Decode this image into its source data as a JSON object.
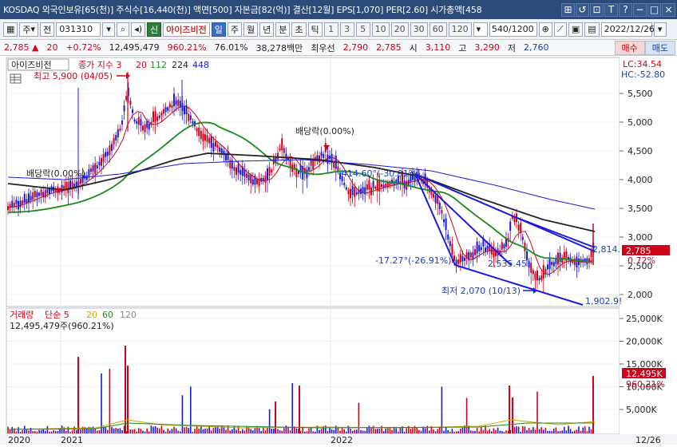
{
  "window": {
    "title": "KOSDAQ 외국인보유[65(천)] 주식수[16,440(천)] 액면[500] 자본금[82(억)] 결산[12월] EPS[1,070] PER[2.60] 시가총액[458",
    "buttons": [
      "⊞",
      "↺",
      "⊡",
      "T",
      "?",
      "−",
      "□",
      "×"
    ]
  },
  "toolbar": {
    "market_label": "주",
    "prev_label": "전",
    "code": "031310",
    "search_icon": "search-icon",
    "sound_icon": "speaker-icon",
    "new_badge": "신",
    "stock_name": "아이즈비전",
    "periods": [
      "일",
      "주",
      "월",
      "년",
      "분",
      "초",
      "틱"
    ],
    "active_period": "일",
    "intervals": [
      "1",
      "3",
      "5",
      "10",
      "20",
      "30",
      "60",
      "120"
    ],
    "count": "540",
    "count_total": "/1200",
    "date": "2022/12/26"
  },
  "quote": {
    "price": "2,785",
    "change_arrow": "▲",
    "change": "20",
    "change_pct": "+0.72%",
    "volume": "12,495,479",
    "volume_ratio": "960.21%",
    "turnover": "76.01%",
    "amount": "38,278백만",
    "pref_label": "최우선",
    "pref_sell": "2,790",
    "pref_buy": "2,785",
    "open_label": "시",
    "open": "3,110",
    "high_label": "고",
    "high": "3,290",
    "low_label": "저",
    "low": "2,760",
    "buy_label": "매수",
    "sell_label": "매도"
  },
  "chart": {
    "stock_tag": "아이즈비전",
    "legend_label": "종가 지수 3",
    "ma_periods": [
      {
        "label": "20",
        "color": "#d0021b"
      },
      {
        "label": "112",
        "color": "#1a8a1a"
      },
      {
        "label": "224",
        "color": "#222222"
      },
      {
        "label": "448",
        "color": "#1a1adb"
      }
    ],
    "lc": "LC:34.54",
    "hc": "HC:-52.80",
    "price_ticks": [
      "5,500",
      "5,000",
      "4,500",
      "4,000",
      "3,500",
      "3,000",
      "2,500",
      "2,000"
    ],
    "annotations": {
      "high": "최고 5,900 (04/05)",
      "low": "최저 2,070 (10/13)",
      "div1": "배당락(0.00%)",
      "div2": "배당락(0.00%)",
      "trend1": "-414.60°(-30.91%)",
      "trend2": "-17.27°(-26.91%)",
      "trend3": "2,535.45",
      "trend4": "2,814.",
      "trend5": "1,902.9!"
    },
    "price_tag": "2,785",
    "pct_tag": "0.72%",
    "volume_legend": {
      "label": "거래량",
      "ma_label": "단순 5",
      "periods": [
        {
          "label": "20",
          "color": "#d4a000"
        },
        {
          "label": "60",
          "color": "#1a8a1a"
        },
        {
          "label": "120",
          "color": "#888888"
        }
      ],
      "current": "12,495,479주(960.21%)"
    },
    "volume_ticks": [
      "25,000K",
      "20,000K",
      "15,000K",
      "10,000K",
      "5,000K"
    ],
    "volume_tag": "12,495K",
    "volume_pct_tag": "960.21%",
    "x_labels": [
      "2020",
      "2021",
      "2022",
      "12/26"
    ],
    "colors": {
      "up": "#d0021b",
      "down": "#1a1adb",
      "accent": "#2c4a7a"
    }
  }
}
